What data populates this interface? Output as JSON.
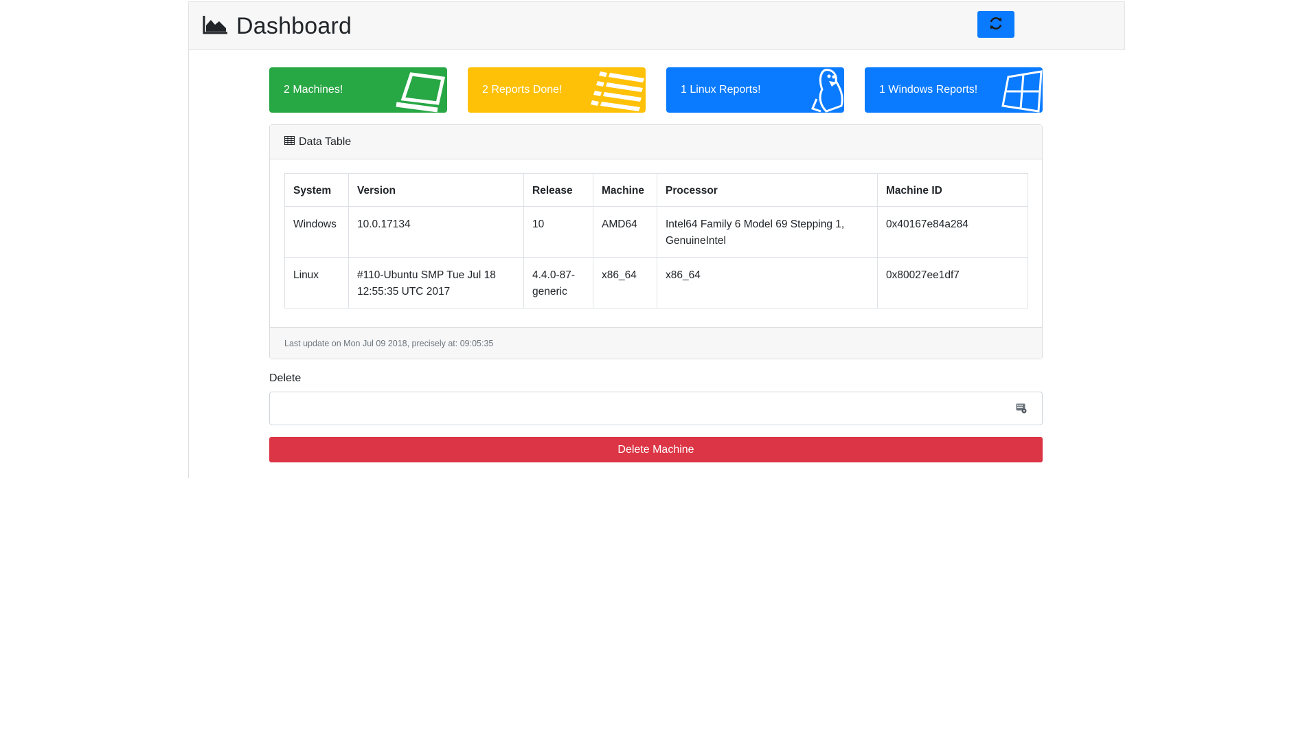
{
  "header": {
    "title": "Dashboard",
    "title_icon": "area-chart-icon",
    "refresh_icon": "refresh-icon"
  },
  "cards": [
    {
      "label": "2 Machines!",
      "icon": "laptop-icon",
      "color": "#28a745"
    },
    {
      "label": "2 Reports Done!",
      "icon": "list-icon",
      "color": "#ffc107"
    },
    {
      "label": "1 Linux Reports!",
      "icon": "linux-icon",
      "color": "#0a7bff"
    },
    {
      "label": "1 Windows Reports!",
      "icon": "windows-icon",
      "color": "#0a7bff"
    }
  ],
  "data_table": {
    "title": "Data Table",
    "title_icon": "table-icon",
    "columns": [
      "System",
      "Version",
      "Release",
      "Machine",
      "Processor",
      "Machine ID"
    ],
    "rows": [
      [
        "Windows",
        "10.0.17134",
        "10",
        "AMD64",
        "Intel64 Family 6 Model 69 Stepping 1, GenuineIntel",
        "0x40167e84a284"
      ],
      [
        "Linux",
        "#110-Ubuntu SMP Tue Jul 18 12:55:35 UTC 2017",
        "4.4.0-87-generic",
        "x86_64",
        "x86_64",
        "0x80027ee1df7"
      ]
    ],
    "footer": "Last update on Mon Jul 09 2018, precisely at: 09:05:35"
  },
  "delete_form": {
    "label": "Delete",
    "input_value": "",
    "input_icon": "keyboard-icon",
    "button_label": "Delete Machine",
    "button_color": "#dc3545"
  }
}
